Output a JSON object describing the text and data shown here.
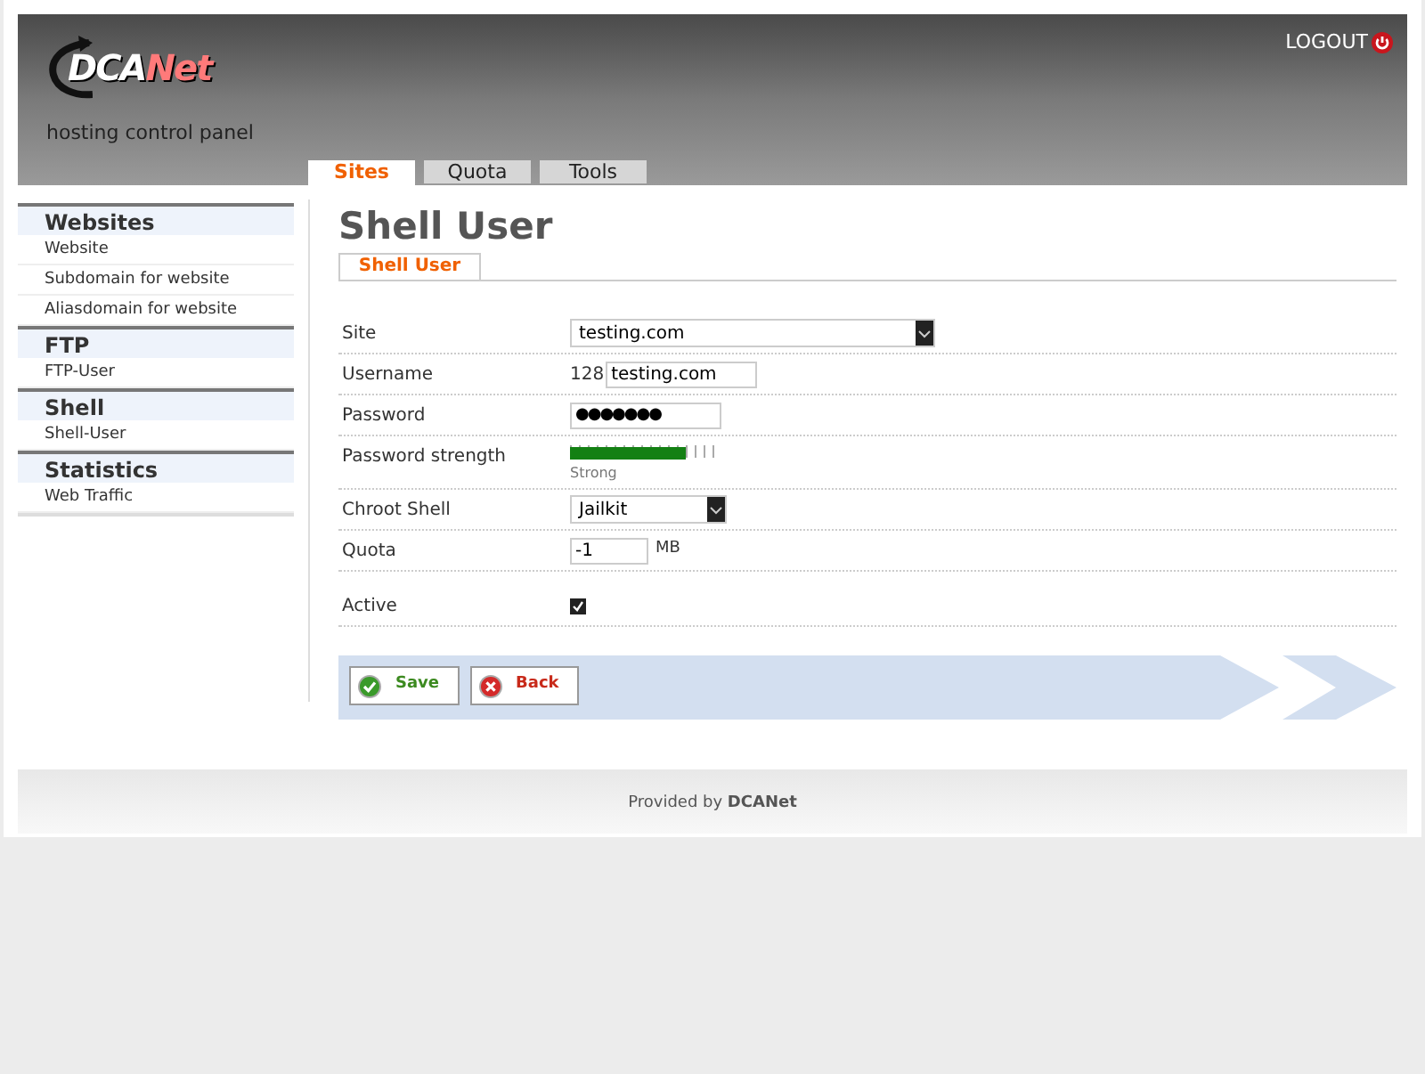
{
  "header": {
    "logo": {
      "part_1": "DCA",
      "part_2": "Net"
    },
    "subtitle": "hosting control panel",
    "logout": "LOGOUT"
  },
  "tabs": [
    {
      "label": "Sites",
      "selected": true
    },
    {
      "label": "Quota",
      "selected": false
    },
    {
      "label": "Tools",
      "selected": false
    }
  ],
  "sidebar": [
    {
      "heading": "Websites",
      "items": [
        "Website",
        "Subdomain for website",
        "Aliasdomain for website"
      ]
    },
    {
      "heading": "FTP",
      "items": [
        "FTP-User"
      ]
    },
    {
      "heading": "Shell",
      "items": [
        "Shell-User"
      ]
    },
    {
      "heading": "Statistics",
      "items": [
        "Web Traffic"
      ]
    }
  ],
  "title": "Shell User",
  "form_tabs": [
    {
      "label": "Shell User",
      "selected": true
    }
  ],
  "fields": [
    {
      "kind": "select",
      "label": "Site",
      "value": "testing.com"
    },
    {
      "kind": "text",
      "label": "Username",
      "prefix": "128",
      "value": "testing.com"
    },
    {
      "kind": "password",
      "label": "Password",
      "value": "●●●●●●●"
    },
    {
      "kind": "meter",
      "label": "Password strength",
      "level": 0.79,
      "reading": "Strong"
    },
    {
      "kind": "select_small",
      "label": "Chroot Shell",
      "value": "Jailkit"
    },
    {
      "kind": "number",
      "label": "Quota",
      "value": "-1",
      "unit": "MB"
    },
    {
      "kind": "checkbox",
      "label": "Active",
      "checked": true
    }
  ],
  "buttons": [
    {
      "kind": "save",
      "label": "Save"
    },
    {
      "kind": "back",
      "label": "Back"
    }
  ],
  "footer": "Provided by **DCANet**"
}
